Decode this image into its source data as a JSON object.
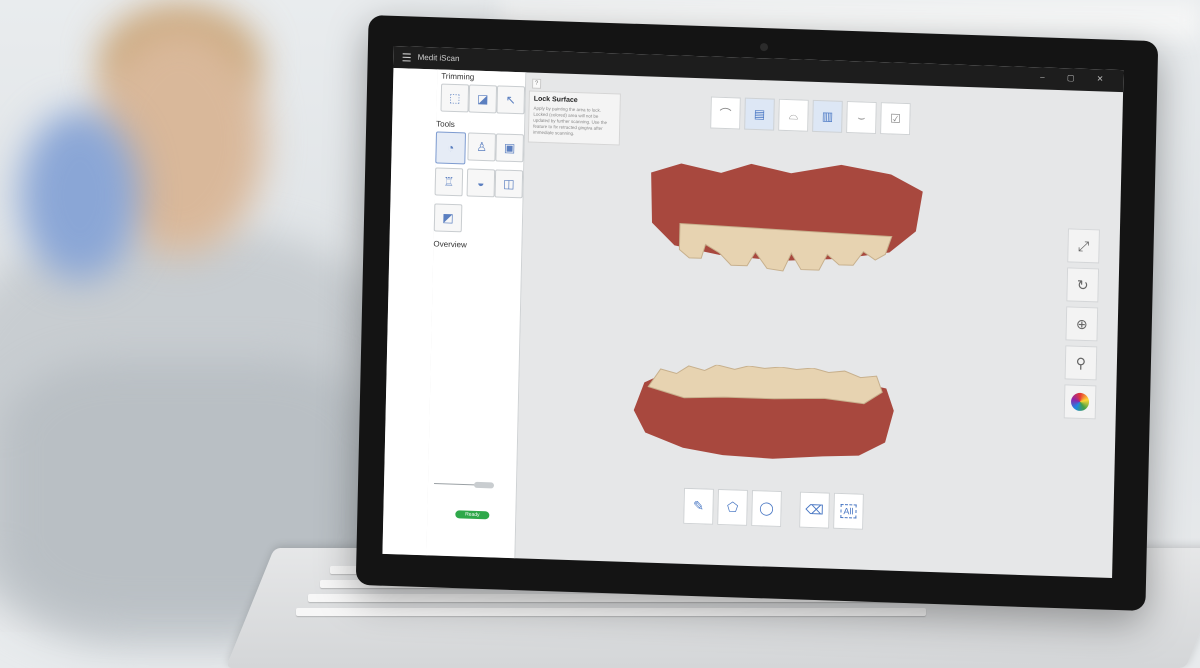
{
  "window": {
    "title": "Medit iScan",
    "controls": [
      "–",
      "▢",
      "✕"
    ]
  },
  "left_panel": {
    "sections": {
      "trimming": "Trimming",
      "tools": "Tools",
      "overview": "Overview"
    },
    "status": "Ready"
  },
  "tooltip": {
    "title": "Lock Surface",
    "body": "Apply by painting the area to lock. Locked (colored) area will not be updated by further scanning. Use the feature to fix retracted gingiva after immediate scanning."
  },
  "bottom_toolbar": {
    "all_label": "All"
  },
  "icons": {
    "trim_brush": "brush-icon",
    "trim_polyline": "polyline-icon",
    "trim_circle": "circle-icon",
    "lock_surface": "lock-surface-icon",
    "fit_screen": "fit-screen-icon",
    "rotate": "rotate-icon",
    "zoom_in": "zoom-in-icon",
    "zoom": "zoom-icon",
    "color_map": "color-map-icon"
  },
  "colors": {
    "status_green": "#2ea84a",
    "accent_blue": "#4a78c4",
    "gingiva": "#a8483e",
    "teeth": "#e7d3b1"
  }
}
